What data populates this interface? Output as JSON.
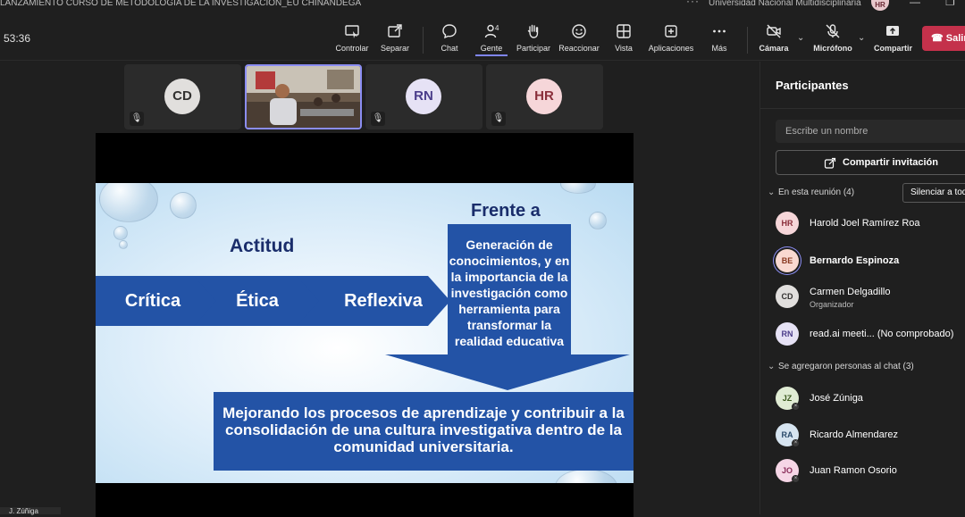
{
  "titlebar": {
    "title": "LANZAMIENTO CURSO DE METODOLOGIA DE LA INVESTIGACION_EU CHINANDEGA",
    "more_icon": "ellipsis-icon",
    "org": "Universidad Nacional Multidisciplinaria",
    "user_initials": "HR"
  },
  "toolbar": {
    "timer": "53:36",
    "buttons": [
      {
        "label": "Controlar",
        "icon": "control-icon"
      },
      {
        "label": "Separar",
        "icon": "popout-icon"
      },
      {
        "label": "Chat",
        "icon": "chat-icon"
      },
      {
        "label": "Gente",
        "icon": "people-icon",
        "count": "4"
      },
      {
        "label": "Participar",
        "icon": "raise-hand-icon"
      },
      {
        "label": "Reaccionar",
        "icon": "react-icon"
      },
      {
        "label": "Vista",
        "icon": "view-icon"
      },
      {
        "label": "Aplicaciones",
        "icon": "apps-icon"
      },
      {
        "label": "Más",
        "icon": "more-icon"
      },
      {
        "label": "Cámara",
        "icon": "camera-off-icon"
      },
      {
        "label": "Micrófono",
        "icon": "mic-off-icon"
      },
      {
        "label": "Compartir",
        "icon": "share-icon"
      }
    ],
    "hangup_label": "Salir"
  },
  "tiles": [
    {
      "initials": "CD",
      "bg": "#e1dfdd",
      "fg": "#323130"
    },
    {
      "initials": "",
      "video": true
    },
    {
      "initials": "RN",
      "bg": "#e6e2f5",
      "fg": "#4b3d8a"
    },
    {
      "initials": "HR",
      "bg": "#f6d6d9",
      "fg": "#8a2e3a"
    }
  ],
  "slide": {
    "frente": "Frente a",
    "actitud": "Actitud",
    "chevrons": [
      "Crítica",
      "Ética",
      "Reflexiva"
    ],
    "arrow_text": "Generación de conocimientos, y en la importancia de la investigación como herramienta para transformar la realidad educativa",
    "bottom_text": "Mejorando los procesos de aprendizaje y contribuir a la consolidación de una cultura investigativa dentro de la comunidad universitaria.",
    "colors": {
      "blue": "#2353a6",
      "title": "#1a2d6b"
    }
  },
  "bottom_name": "J. Zúñiga",
  "panel": {
    "title": "Participantes",
    "search_placeholder": "Escribe un nombre",
    "invite_label": "Compartir invitación",
    "in_meeting_label": "En esta reunión (4)",
    "mute_all_label": "Silenciar a todos",
    "added_label": "Se agregaron personas al chat (3)",
    "in_meeting": [
      {
        "initials": "HR",
        "name": "Harold Joel Ramírez Roa",
        "bg": "#f6d6d9",
        "fg": "#8a2e3a"
      },
      {
        "initials": "BE",
        "name": "Bernardo Espinoza",
        "bg": "#f9d9d1",
        "fg": "#8a3a22",
        "speaking": true
      },
      {
        "initials": "CD",
        "name": "Carmen Delgadillo",
        "role": "Organizador",
        "bg": "#e1dfdd",
        "fg": "#323130"
      },
      {
        "initials": "RN",
        "name": "read.ai meeti... (No comprobado)",
        "bg": "#e6e2f5",
        "fg": "#4b3d8a"
      }
    ],
    "added": [
      {
        "initials": "JZ",
        "name": "José Zúniga",
        "bg": "#e0ecd4",
        "fg": "#3d5a20"
      },
      {
        "initials": "RA",
        "name": "Ricardo Almendarez",
        "bg": "#d6e4f0",
        "fg": "#2a4a6b"
      },
      {
        "initials": "JO",
        "name": "Juan Ramon Osorio",
        "bg": "#f6d6e6",
        "fg": "#8a2e5a"
      }
    ]
  }
}
